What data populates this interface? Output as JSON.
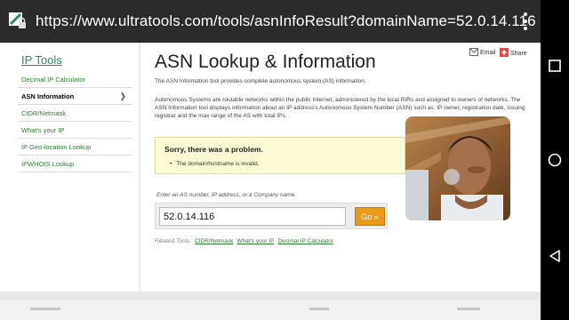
{
  "browser": {
    "url": "https://www.ultratools.com/tools/asnInfoResult?domainName=52.0.14.116"
  },
  "sidebar": {
    "title": "IP Tools",
    "items": [
      {
        "label": "Decimal IP Calculator"
      },
      {
        "label": "ASN Information",
        "active": true
      },
      {
        "label": "CIDR/Netmask"
      },
      {
        "label": "What's your IP"
      },
      {
        "label": "IP Geo-location Lookup"
      },
      {
        "label": "IPWHOIS Lookup"
      }
    ]
  },
  "main": {
    "title": "ASN Lookup & Information",
    "email_label": "Email",
    "share_label": "Share",
    "intro": "The ASN Information tool provides complete autonomous system (AS) information.",
    "description": "Autonomous Systems are routable networks within the public Internet, administered by the local RIRs and assigned to owners of networks. The ASN Information tool displays information about an IP address's Autonomous System Number (ASN) such as: IP owner, registration date, issuing registrar and the max range of the AS with total IPs.",
    "alert": {
      "title": "Sorry, there was a problem.",
      "message": "The domain/hostname is invalid."
    },
    "search": {
      "hint": "Enter an AS number, IP address, or a Company name.",
      "value": "52.0.14.116",
      "button_label": "Go »"
    },
    "related": {
      "label": "Related Tools:",
      "links": [
        "CIDR/Netmask",
        "What's your IP",
        "Decimal IP Calculator"
      ]
    }
  },
  "colors": {
    "brand_green": "#2e8b57",
    "go_button": "#e89a1a",
    "alert_bg": "#fdfbd6"
  },
  "icons": [
    "lock-icon",
    "menu-overflow-icon",
    "email-icon",
    "share-icon",
    "back-nav-icon",
    "home-nav-icon",
    "recents-nav-icon",
    "webcam-overlay"
  ]
}
